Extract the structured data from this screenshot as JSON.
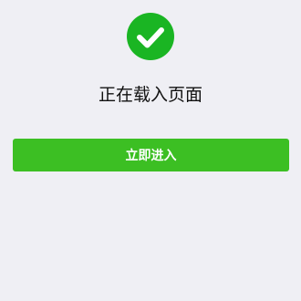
{
  "icon": {
    "name": "check-circle-icon",
    "color": "#1ab523"
  },
  "status": {
    "text": "正在载入页面"
  },
  "actions": {
    "enter_label": "立即进入",
    "enter_color": "#3cbf23"
  },
  "colors": {
    "background": "#efeff4",
    "text": "#111111"
  }
}
